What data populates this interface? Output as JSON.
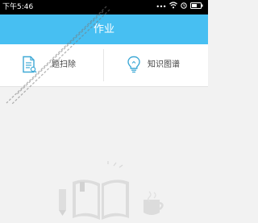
{
  "status_bar": {
    "time": "下午5:46"
  },
  "header": {
    "title": "作业"
  },
  "toolbar": {
    "scan": {
      "label": "题扫除",
      "icon": "document-scan-icon"
    },
    "knowledge": {
      "label": "知识图谱",
      "icon": "lightbulb-icon"
    }
  },
  "empty_state": {
    "icons": [
      "book-icon",
      "pencil-icon",
      "mug-icon"
    ]
  },
  "colors": {
    "status_bar": "#000000",
    "header": "#47bff2",
    "accent_icon": "#3fa9d6",
    "background": "#f2f2f2"
  }
}
